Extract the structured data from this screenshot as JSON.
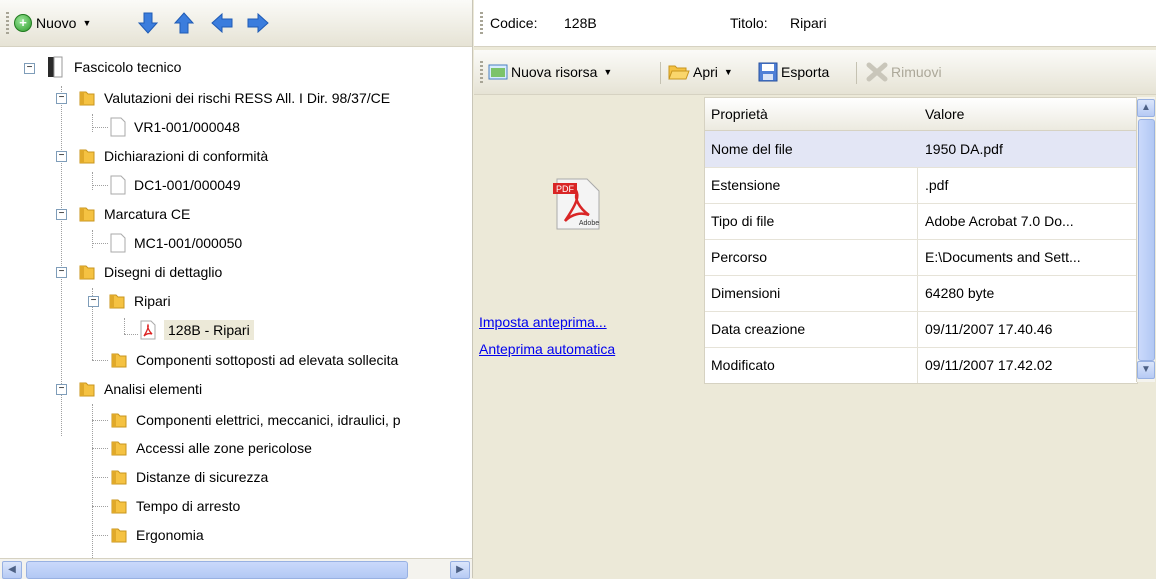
{
  "toolbar": {
    "new_label": "Nuovo"
  },
  "tree": {
    "root": "Fascicolo tecnico",
    "items": [
      "Valutazioni dei rischi RESS All. I Dir. 98/37/CE",
      "VR1-001/000048",
      "Dichiarazioni di conformità",
      "DC1-001/000049",
      "Marcatura CE",
      "MC1-001/000050",
      "Disegni di dettaglio",
      "Ripari",
      "128B - Ripari",
      "Componenti sottoposti ad elevata sollecita",
      "Analisi elementi",
      "Componenti elettrici, meccanici, idraulici, p",
      "Accessi alle zone pericolose",
      "Distanze di sicurezza",
      "Tempo di arresto",
      "Ergonomia"
    ]
  },
  "header": {
    "code_label": "Codice:",
    "code_value": "128B",
    "title_label": "Titolo:",
    "title_value": "Ripari"
  },
  "resource_toolbar": {
    "new_resource": "Nuova risorsa",
    "open": "Apri",
    "export": "Esporta",
    "remove": "Rimuovi"
  },
  "preview": {
    "icon_label": "PDF",
    "icon_brand": "Adobe",
    "set_preview": "Imposta anteprima...",
    "auto_preview": "Anteprima automatica"
  },
  "properties": {
    "col_property": "Proprietà",
    "col_value": "Valore",
    "rows": [
      {
        "name": "Nome del file",
        "value": "1950 DA.pdf"
      },
      {
        "name": "Estensione",
        "value": ".pdf"
      },
      {
        "name": "Tipo di file",
        "value": "Adobe Acrobat 7.0 Do..."
      },
      {
        "name": "Percorso",
        "value": "E:\\Documents and Sett..."
      },
      {
        "name": "Dimensioni",
        "value": "64280 byte"
      },
      {
        "name": "Data creazione",
        "value": "09/11/2007 17.40.46"
      },
      {
        "name": "Modificato",
        "value": "09/11/2007 17.42.02"
      }
    ]
  },
  "colors": {
    "folder": "#f5c242",
    "arrow_blue": "#3b7ddd",
    "link": "#0000ee",
    "selected_row": "#e3e6f5"
  }
}
